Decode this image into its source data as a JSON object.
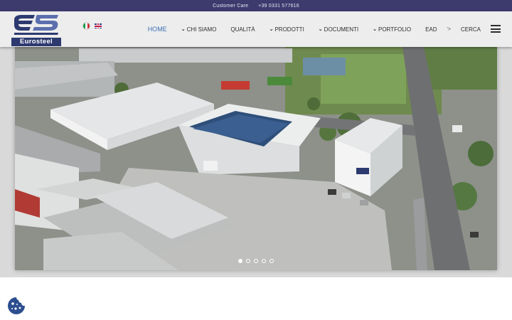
{
  "topbar": {
    "customer_care": "Customer Care",
    "phone": "+39 0331 577616"
  },
  "logo": {
    "mark_text": "es",
    "text": "Eurosteel",
    "colors": {
      "primary": "#2d3a70",
      "light": "#5b6fae"
    }
  },
  "languages": [
    {
      "code": "it",
      "icon": "italy-flag-icon"
    },
    {
      "code": "en",
      "icon": "uk-flag-icon"
    }
  ],
  "nav": {
    "items": [
      {
        "label": "HOME",
        "active": true,
        "dropdown": false
      },
      {
        "label": "CHI SIAMO",
        "active": false,
        "dropdown": true
      },
      {
        "label": "QUALITÀ",
        "active": false,
        "dropdown": false
      },
      {
        "label": "PRODOTTI",
        "active": false,
        "dropdown": true
      },
      {
        "label": "DOCUMENTI",
        "active": false,
        "dropdown": true
      },
      {
        "label": "PORTFOLIO",
        "active": false,
        "dropdown": true
      },
      {
        "label": "EAD",
        "active": false,
        "dropdown": false
      }
    ],
    "separator": "'>",
    "search_label": "CERCA",
    "menu_icon": "hamburger-menu-icon",
    "chevron_glyph": "❯",
    "active_color": "#3a6fb5"
  },
  "hero": {
    "image": "aerial-view-of-eurosteel-factory",
    "slides": 5,
    "active_slide": 1
  },
  "cookie": {
    "icon": "cookie-icon",
    "color": "#2d4f8f"
  },
  "colors": {
    "topbar": "#3d3a6e",
    "header": "#ededed",
    "accent": "#3a6fb5"
  }
}
